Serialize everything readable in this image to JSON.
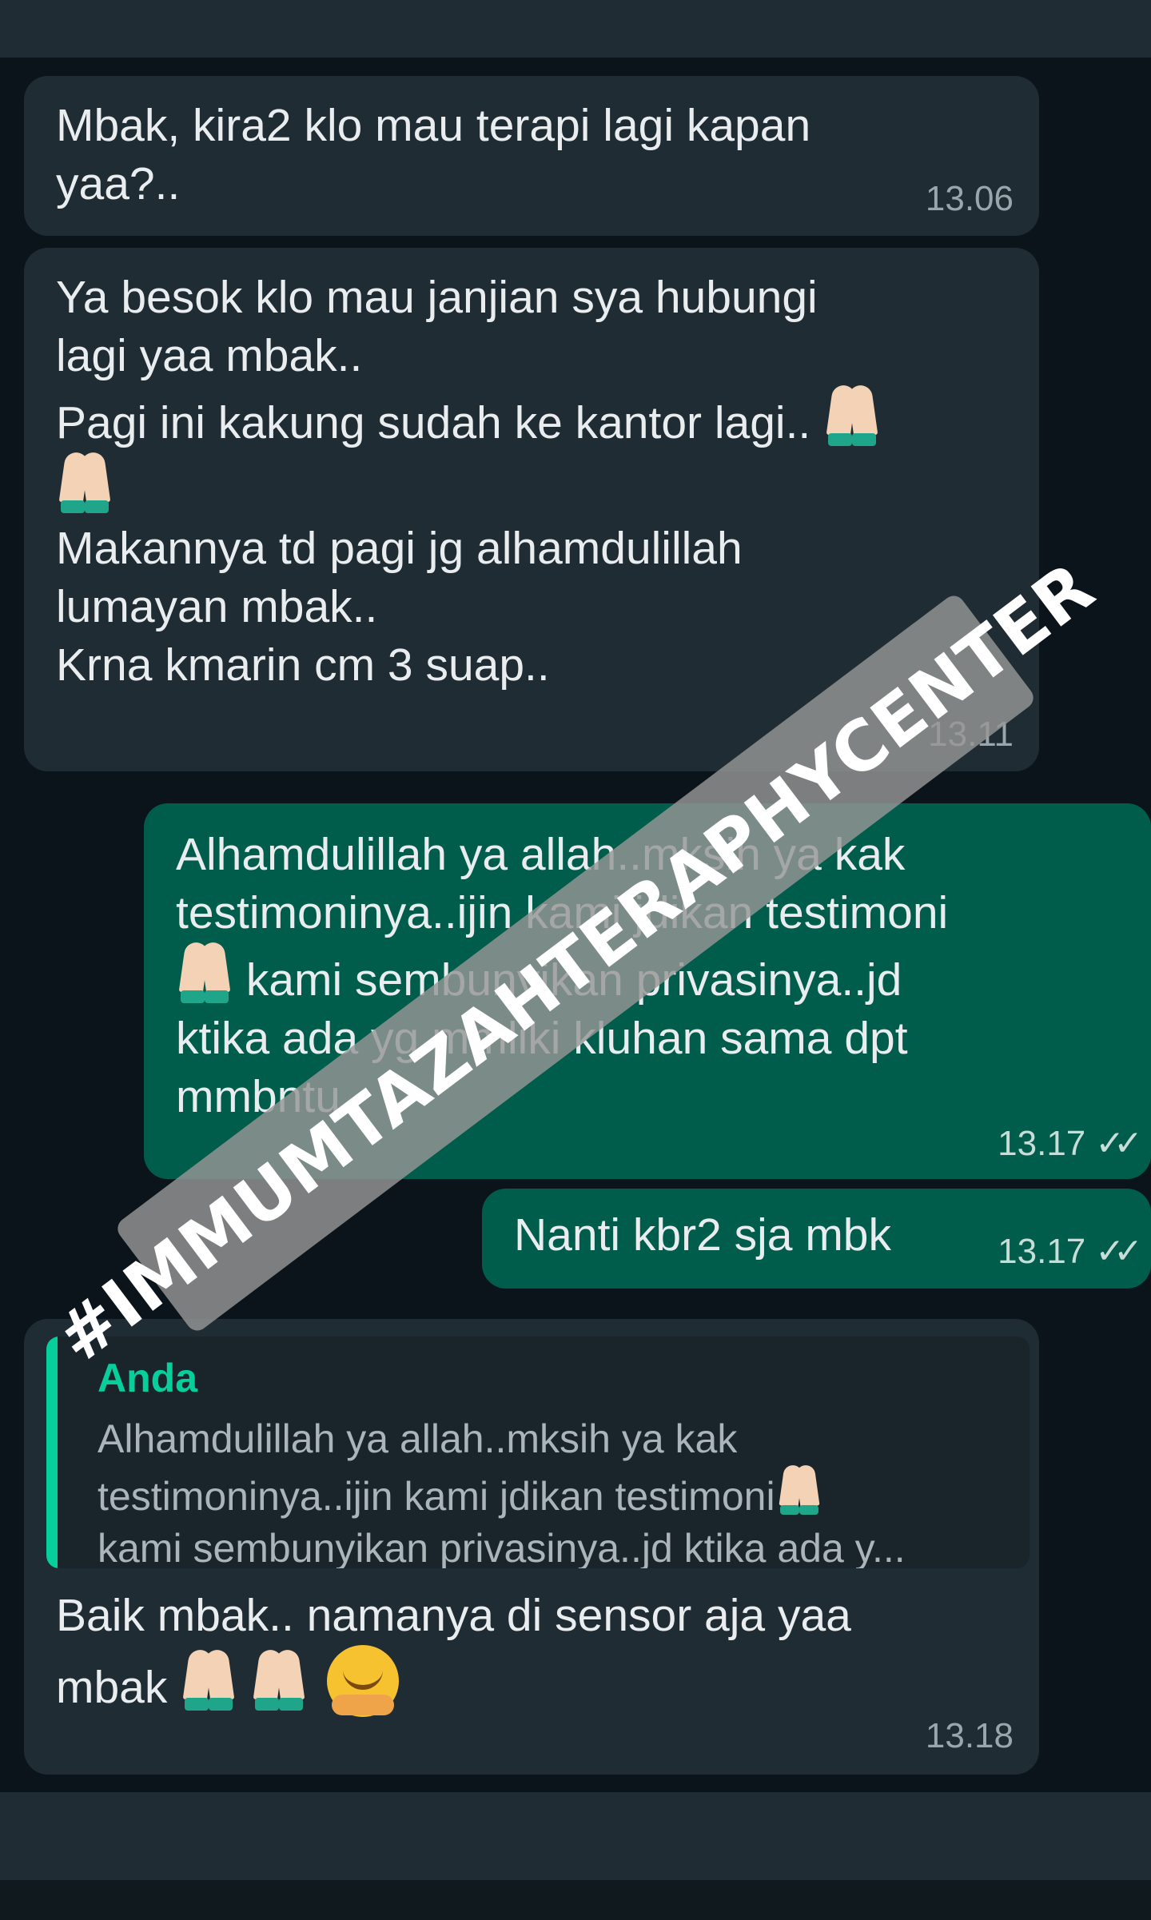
{
  "messages": [
    {
      "direction": "incoming",
      "lines": [
        "Mbak, kira2 klo mau terapi lagi kapan",
        "yaa?.."
      ],
      "time": "13.06"
    },
    {
      "direction": "incoming",
      "lines": [
        "Ya besok klo mau janjian sya hubungi",
        "lagi yaa mbak..",
        "Pagi ini kakung sudah ke kantor lagi..",
        "",
        "Makannya td pagi jg alhamdulillah",
        "lumayan mbak..",
        "Krna kmarin cm 3 suap.."
      ],
      "time": "13.11"
    },
    {
      "direction": "outgoing",
      "lines": [
        "Alhamdulillah ya allah..mksih ya kak",
        "testimoninya..ijin kami jdikan testimoni",
        "kami sembunyikan privasinya..jd",
        "ktika ada yg mmliki kluhan sama dpt",
        "mmbntu"
      ],
      "time": "13.17",
      "status": "read"
    },
    {
      "direction": "outgoing",
      "lines": [
        "Nanti kbr2 sja mbk"
      ],
      "time": "13.17",
      "status": "read"
    },
    {
      "direction": "incoming",
      "reply_to": {
        "author": "Anda",
        "lines": [
          "Alhamdulillah ya allah..mksih ya kak",
          "testimoninya..ijin kami jdikan testimoni",
          "kami sembunyikan privasinya..jd ktika ada y..."
        ]
      },
      "lines": [
        "Baik mbak.. namanya di sensor aja yaa",
        "mbak"
      ],
      "time": "13.18"
    }
  ],
  "watermark": "#IMMUMTAZAHTERAPHYCENTER",
  "icons": {
    "pray": "folded-hands-emoji",
    "hug": "smiling-face-with-open-hands-emoji",
    "read": "double-check-icon"
  },
  "colors": {
    "background": "#0b141a",
    "incoming_bubble": "#202c33",
    "outgoing_bubble": "#005c4b",
    "reply_accent": "#06cf9c",
    "watermark": "#969696"
  }
}
